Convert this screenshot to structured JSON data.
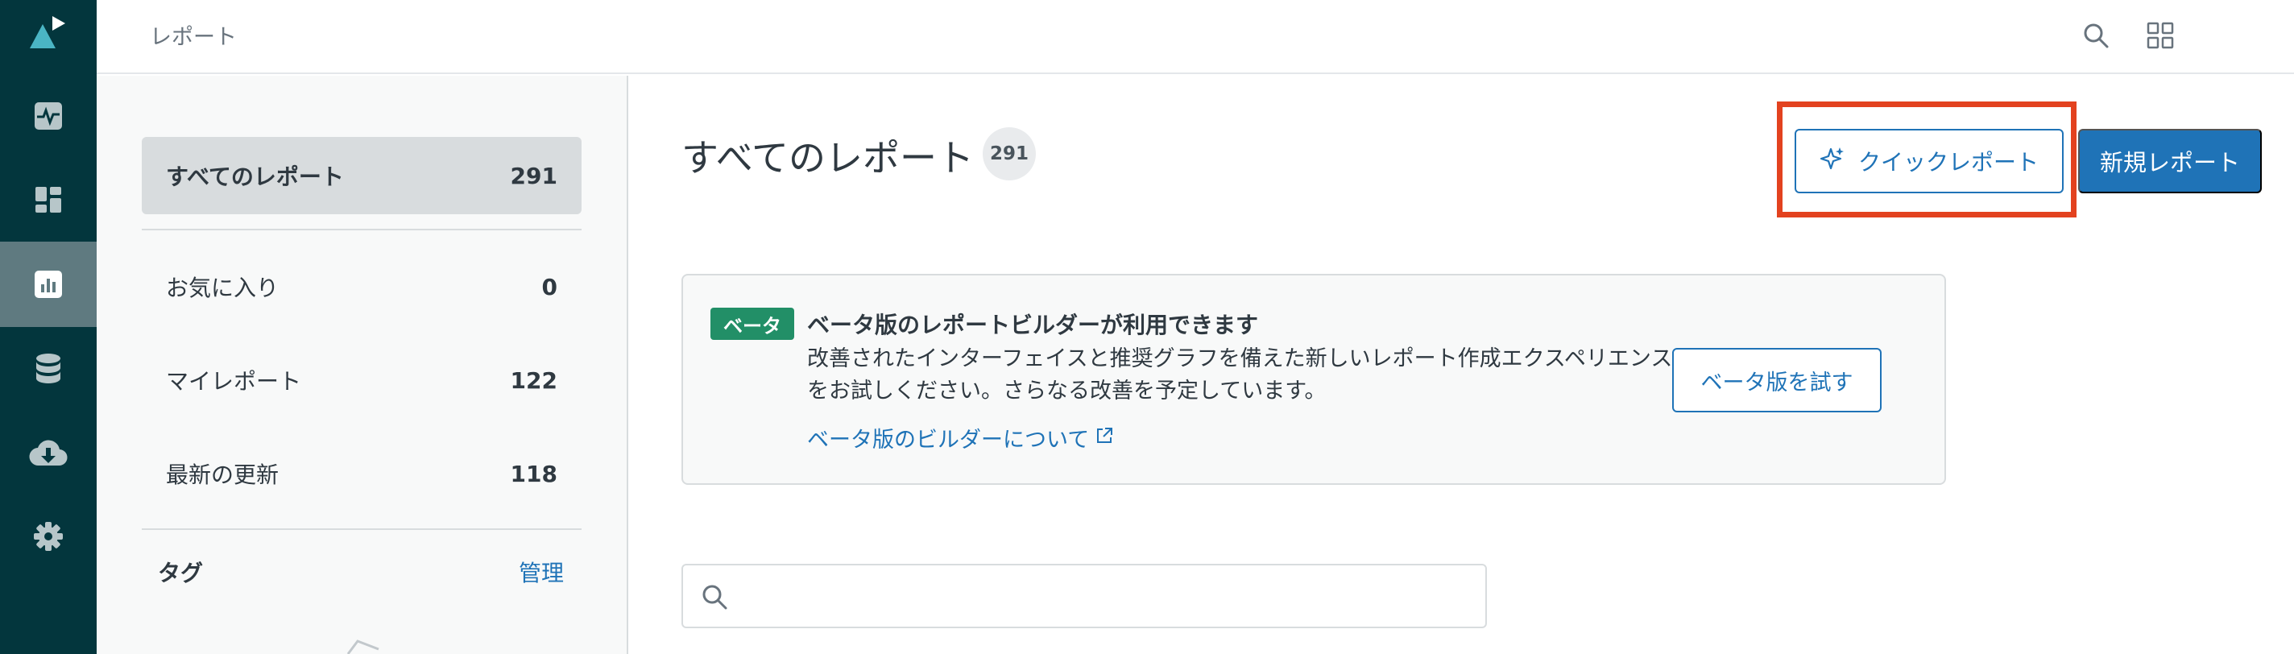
{
  "header": {
    "breadcrumb": "レポート",
    "icons": [
      "search-icon",
      "apps-grid-icon"
    ]
  },
  "rail": {
    "logo": "explore-logo",
    "items": [
      {
        "icon": "pulse-icon",
        "active": false
      },
      {
        "icon": "dashboard-icon",
        "active": false
      },
      {
        "icon": "reports-chart-icon",
        "active": true
      },
      {
        "icon": "datasets-icon",
        "active": false
      },
      {
        "icon": "cloud-download-icon",
        "active": false
      },
      {
        "icon": "gear-icon",
        "active": false
      }
    ],
    "colors": {
      "background": "#03363d",
      "active": "#5f7a80"
    }
  },
  "filters": {
    "all": {
      "label": "すべてのレポート",
      "count": "291"
    },
    "favorites": {
      "label": "お気に入り",
      "count": "0"
    },
    "mine": {
      "label": "マイレポート",
      "count": "122"
    },
    "recent": {
      "label": "最新の更新",
      "count": "118"
    },
    "tags_label": "タグ",
    "manage_label": "管理"
  },
  "main": {
    "title": "すべてのレポート",
    "count": "291",
    "quick_report_label": "クイックレポート",
    "new_report_label": "新規レポート"
  },
  "beta": {
    "badge": "ベータ",
    "title": "ベータ版のレポートビルダーが利用できます",
    "description": "改善されたインターフェイスと推奨グラフを備えた新しいレポート作成エクスペリエンスをお試しください。さらなる改善を予定しています。",
    "link": "ベータ版のビルダーについて",
    "try_button": "ベータ版を試す"
  },
  "search": {
    "value": "",
    "placeholder": ""
  },
  "colors": {
    "accent": "#1f73b7",
    "highlight": "#e3421f",
    "badge_green": "#228f67"
  }
}
